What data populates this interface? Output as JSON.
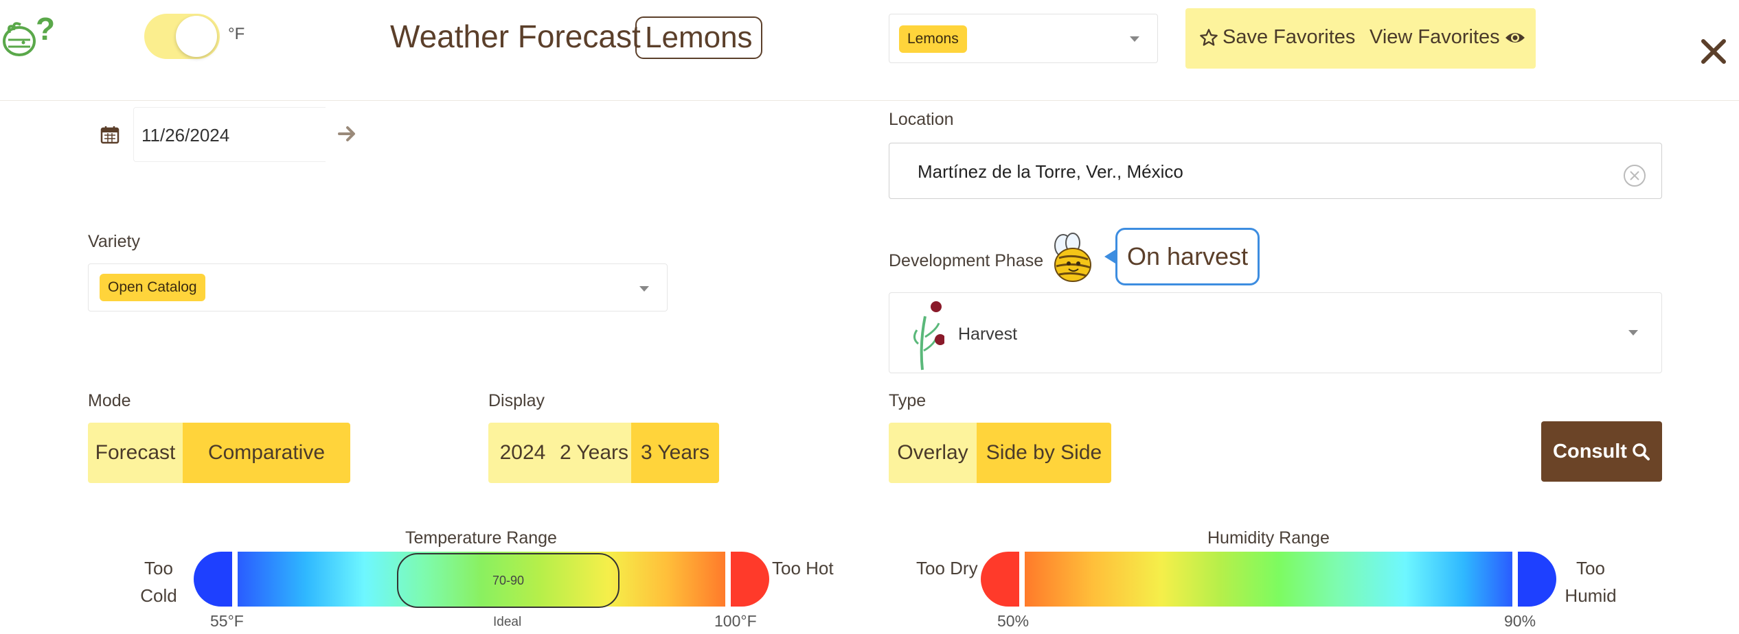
{
  "header": {
    "temp_unit": "°F",
    "title": "Weather Forecast",
    "title_badge": "Lemons",
    "crop_select": {
      "value": "Lemons"
    },
    "save_favorites": "Save Favorites",
    "view_favorites": "View Favorites"
  },
  "date": {
    "value": "11/26/2024"
  },
  "location": {
    "label": "Location",
    "value": "Martínez de la Torre, Ver., México"
  },
  "variety": {
    "label": "Variety",
    "value": "Open Catalog"
  },
  "development_phase": {
    "label": "Development Phase",
    "bubble": "On harvest",
    "value": "Harvest"
  },
  "mode": {
    "label": "Mode",
    "options": [
      "Forecast",
      "Comparative"
    ],
    "selected": "Comparative"
  },
  "display": {
    "label": "Display",
    "options": [
      "2024",
      "2 Years",
      "3 Years"
    ],
    "selected": "3 Years"
  },
  "type": {
    "label": "Type",
    "options": [
      "Overlay",
      "Side by Side"
    ],
    "selected": "Side by Side"
  },
  "consult": {
    "label": "Consult"
  },
  "temperature_range": {
    "title": "Temperature Range",
    "low_label_line1": "Too",
    "low_label_line2": "Cold",
    "high_label": "Too Hot",
    "min_tick": "55°F",
    "max_tick": "100°F",
    "ideal_range": "70-90",
    "ideal_label": "Ideal"
  },
  "humidity_range": {
    "title": "Humidity Range",
    "low_label": "Too Dry",
    "high_label_line1": "Too",
    "high_label_line2": "Humid",
    "min_tick": "50%",
    "max_tick": "90%"
  },
  "colors": {
    "accent_yellow": "#ffd43b",
    "light_yellow": "#fdf39c",
    "brown": "#6b4427",
    "bubble_blue": "#3d8de0"
  }
}
